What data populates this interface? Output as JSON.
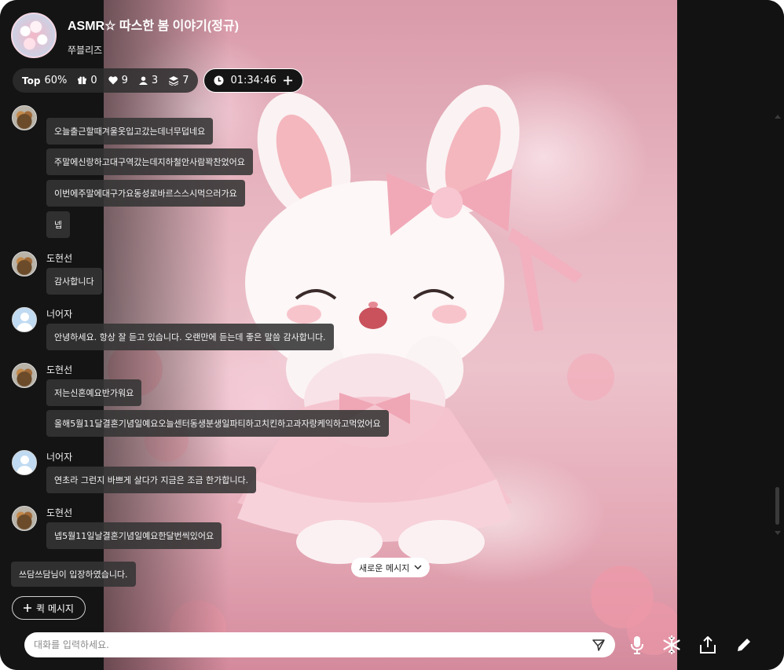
{
  "header": {
    "title": "ASMR☆ 따스한 봄 이야기(정규)",
    "host": "쭈블리즈"
  },
  "stats": {
    "top_label": "Top",
    "top_value": "60%",
    "gifts": "0",
    "likes": "9",
    "listeners": "3",
    "layers": "7",
    "timer": "01:34:46"
  },
  "messages": [
    {
      "name": "",
      "avatar": "photo",
      "bubbles": [
        "오늘출근할때겨울옷입고갔는데너무덥네요",
        "주말에신랑하고대구역갔는데지하철안사람꽉찬었어요",
        "이번에주말에대구가요동성로바르스스시먹으러가요",
        "넵"
      ]
    },
    {
      "name": "도현선",
      "avatar": "photo",
      "bubbles": [
        "감사합니다"
      ]
    },
    {
      "name": "너어자",
      "avatar": "default",
      "bubbles": [
        "안녕하세요. 항상 잘 듣고 있습니다. 오랜만에 듣는데 좋은 말씀 감사합니다."
      ]
    },
    {
      "name": "도현선",
      "avatar": "photo",
      "bubbles": [
        "저는신혼예요반가워요",
        "올해5월11달결혼기념일예요오늘센터동생분생일파티하고치킨하고과자랑케익하고먹었어요"
      ]
    },
    {
      "name": "너어자",
      "avatar": "default",
      "bubbles": [
        "연초라 그런지 바쁘게 살다가 지금은 조금 한가합니다."
      ]
    },
    {
      "name": "도현선",
      "avatar": "photo",
      "bubbles": [
        "넵5월11일날결혼기념일예요한달번씩있어요"
      ]
    }
  ],
  "system_message": "쓰담쓰담님이 입장하였습니다.",
  "new_message_button": "새로운 메시지",
  "quick_message_button": "퀵 메시지",
  "input": {
    "placeholder": "대화를 입력하세요.",
    "value": ""
  },
  "toolbar_icons": [
    "microphone-icon",
    "snowflake-icon",
    "share-icon",
    "pencil-icon"
  ],
  "colors": {
    "panel": "#121212",
    "bubble": "#343434",
    "background_pink": "#e7b5c0"
  }
}
